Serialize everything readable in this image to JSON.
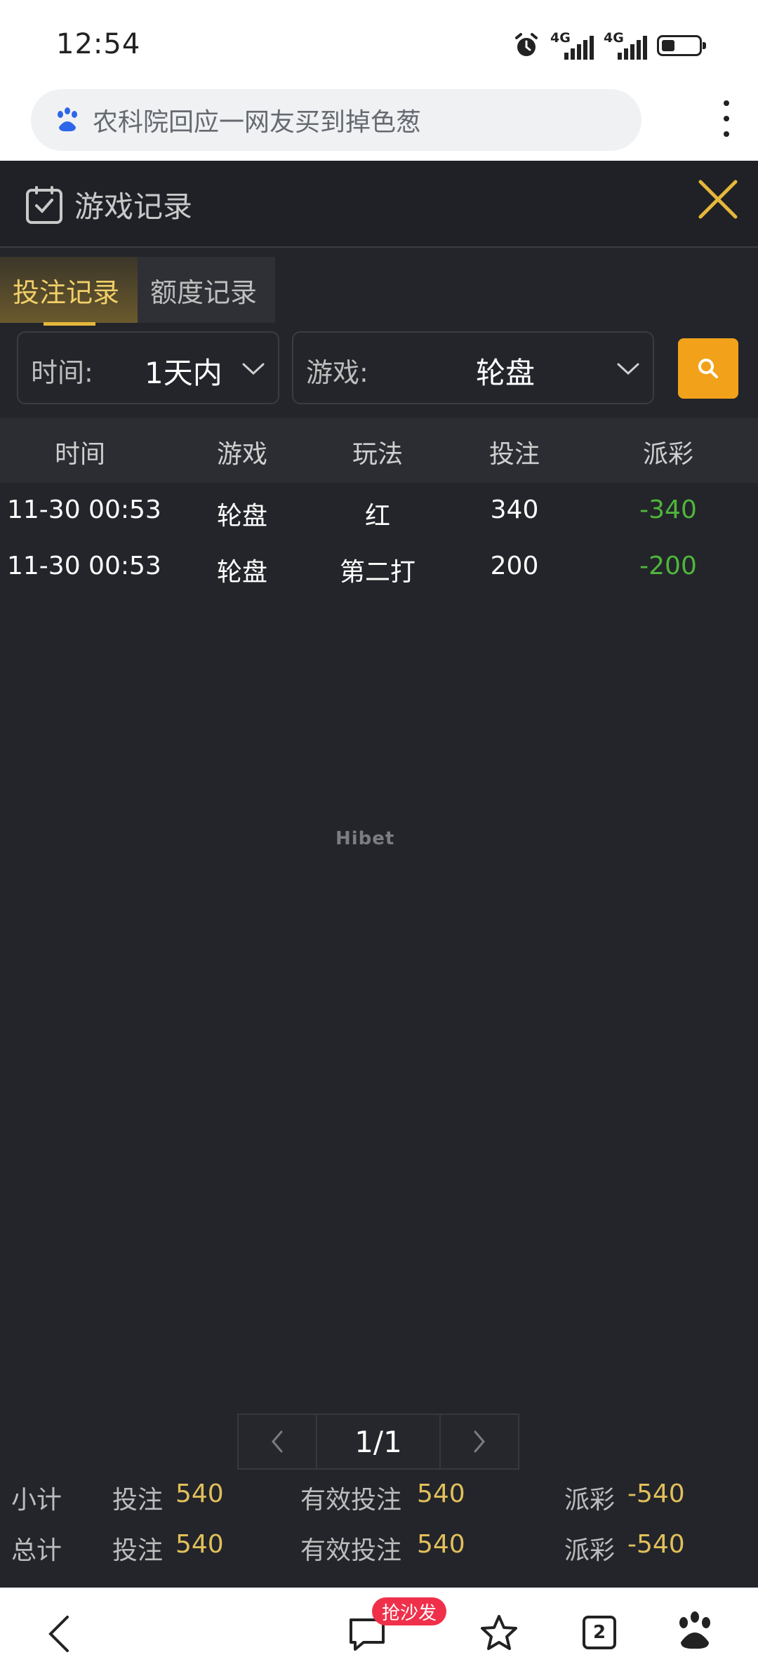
{
  "status_bar": {
    "time": "12:54",
    "net1": "4G",
    "net2": "4G"
  },
  "browser": {
    "query": "农科院回应一网友买到掉色葱"
  },
  "modal": {
    "title": "游戏记录",
    "tabs": [
      {
        "label": "投注记录",
        "active": true
      },
      {
        "label": "额度记录",
        "active": false
      }
    ]
  },
  "filters": {
    "time_label": "时间:",
    "time_value": "1天内",
    "game_label": "游戏:",
    "game_value": "轮盘"
  },
  "table": {
    "headers": [
      "时间",
      "游戏",
      "玩法",
      "投注",
      "派彩"
    ],
    "rows": [
      {
        "time": "11-30 00:53",
        "game": "轮盘",
        "play": "红",
        "bet": "340",
        "payout": "-340"
      },
      {
        "time": "11-30 00:53",
        "game": "轮盘",
        "play": "第二打",
        "bet": "200",
        "payout": "-200"
      }
    ]
  },
  "watermark": "Hibet",
  "pagination": {
    "current": "1/1"
  },
  "summary": {
    "subtotal": {
      "label": "小计",
      "bet_label": "投注",
      "bet": "540",
      "valid_label": "有效投注",
      "valid": "540",
      "payout_label": "派彩",
      "payout": "-540"
    },
    "total": {
      "label": "总计",
      "bet_label": "投注",
      "bet": "540",
      "valid_label": "有效投注",
      "valid": "540",
      "payout_label": "派彩",
      "payout": "-540"
    }
  },
  "bottom_nav": {
    "comment_badge": "抢沙发",
    "tab_count": "2"
  },
  "colors": {
    "accent": "#f2a21a",
    "gold_text": "#e1bf5a",
    "loss_green": "#4fb53c",
    "bg": "#23252a"
  }
}
